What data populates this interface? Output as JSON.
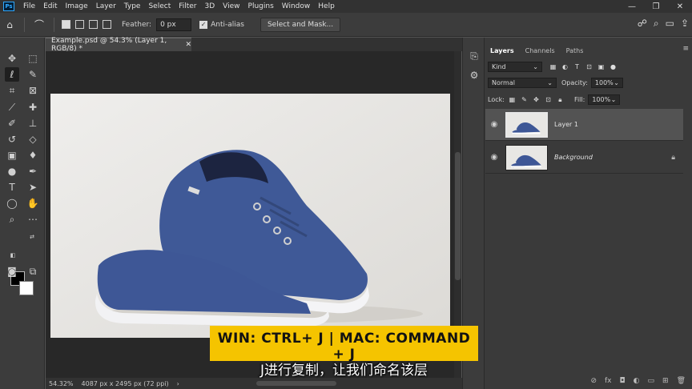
{
  "app": {
    "logo": "Ps"
  },
  "menubar": {
    "items": [
      "File",
      "Edit",
      "Image",
      "Layer",
      "Type",
      "Select",
      "Filter",
      "3D",
      "View",
      "Plugins",
      "Window",
      "Help"
    ]
  },
  "window_controls": {
    "minimize": "—",
    "restore": "❐",
    "close": "✕"
  },
  "options_bar": {
    "feather_label": "Feather:",
    "feather_value": "0 px",
    "antialias_label": "Anti-alias",
    "select_mask_label": "Select and Mask..."
  },
  "document": {
    "tab_title": "Example.psd @ 54.3% (Layer 1, RGB/8) *",
    "tab_close": "✕"
  },
  "statusbar": {
    "zoom": "54.32%",
    "info": "4087 px x 2495 px (72 ppi)",
    "arrow": "›"
  },
  "layers_panel": {
    "tabs": [
      "Layers",
      "Channels",
      "Paths"
    ],
    "menu_icon": "≡",
    "kind_label": "Kind",
    "blend_mode": "Normal",
    "opacity_label": "Opacity:",
    "opacity_value": "100%",
    "lock_label": "Lock:",
    "fill_label": "Fill:",
    "fill_value": "100%",
    "layers": [
      {
        "name": "Layer 1",
        "selected": true
      },
      {
        "name": "Background",
        "selected": false,
        "locked": true
      }
    ]
  },
  "overlay": {
    "shortcut": "WIN: CTRL+ J | MAC: COMMAND + J",
    "subtitle": "J进行复制，让我们命名该层"
  },
  "colors": {
    "banner": "#f5c400",
    "fg": "#000000",
    "bg": "#ffffff",
    "shoe": "#3e5797"
  }
}
